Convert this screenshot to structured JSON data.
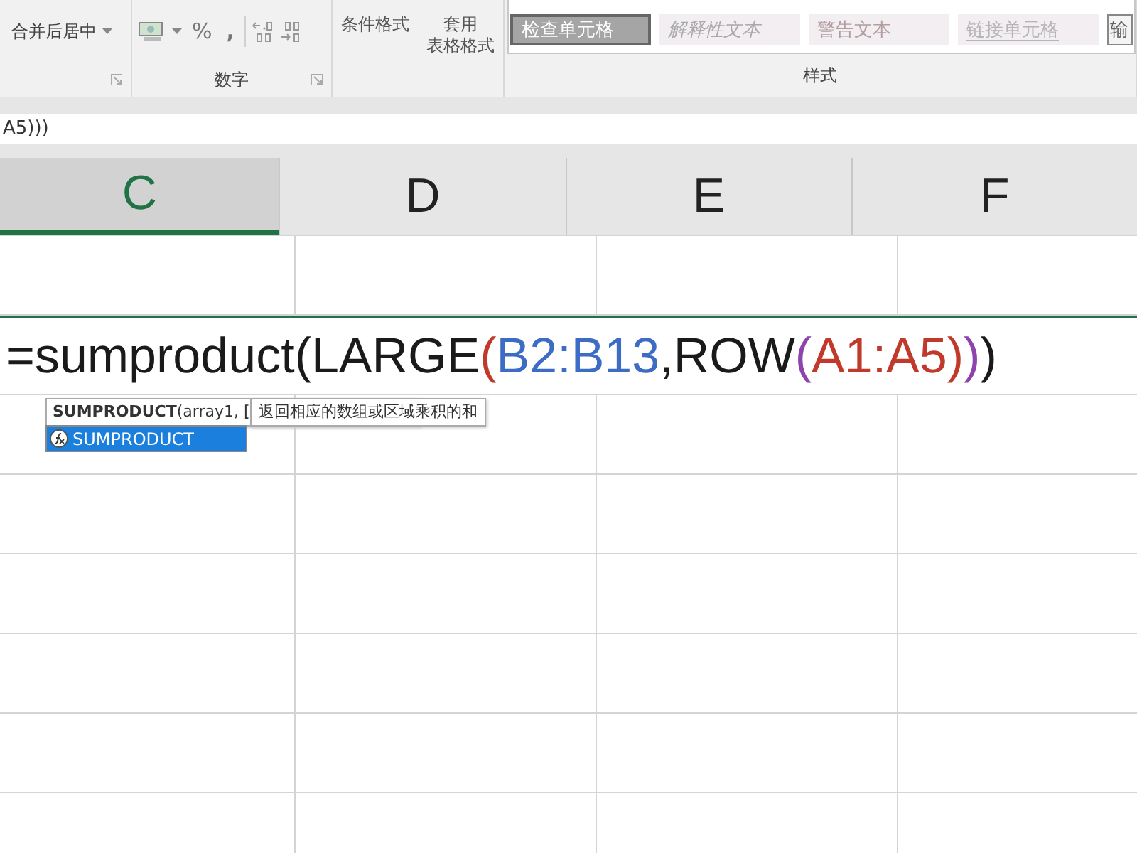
{
  "ribbon": {
    "merge_button": {
      "label": "合并后居中"
    },
    "number_group": {
      "label": "数字",
      "percent": "%",
      "comma": ","
    },
    "conditional_format": {
      "label": "条件格式"
    },
    "table_format": {
      "lines": [
        "套用",
        "表格格式"
      ]
    },
    "styles": [
      {
        "label": "检查单元格",
        "kind": "check"
      },
      {
        "label": "解释性文本",
        "kind": "explanatory"
      },
      {
        "label": "警告文本",
        "kind": "warning"
      },
      {
        "label": "链接单元格",
        "kind": "linked"
      },
      {
        "label": "输",
        "kind": "input"
      }
    ],
    "styles_group": {
      "label": "样式"
    }
  },
  "formula_bar": {
    "value": "A5)))"
  },
  "columns": [
    {
      "label": "C",
      "selected": true
    },
    {
      "label": "D",
      "selected": false
    },
    {
      "label": "E",
      "selected": false
    },
    {
      "label": "F",
      "selected": false
    }
  ],
  "editing_cell": {
    "segments": [
      {
        "text": "=sumproduct",
        "color": "#1a1a1a"
      },
      {
        "text": "(LARGE",
        "color": "#1a1a1a"
      },
      {
        "text": "(",
        "color": "#c0392b"
      },
      {
        "text": "B2:B13",
        "color": "#3d6cc4"
      },
      {
        "text": ",ROW",
        "color": "#1a1a1a"
      },
      {
        "text": "(",
        "color": "#8e44ad"
      },
      {
        "text": "A1:A5",
        "color": "#c0392b"
      },
      {
        "text": ")",
        "color": "#c0392b"
      },
      {
        "text": ")",
        "color": "#8e44ad"
      },
      {
        "text": ")",
        "color": "#1a1a1a"
      }
    ]
  },
  "autocomplete": {
    "signature": "**SUMPRODUCT**(array1, [",
    "description": "返回相应的数组或区域乘积的和",
    "items": [
      {
        "label": "SUMPRODUCT",
        "selected": true
      }
    ]
  }
}
